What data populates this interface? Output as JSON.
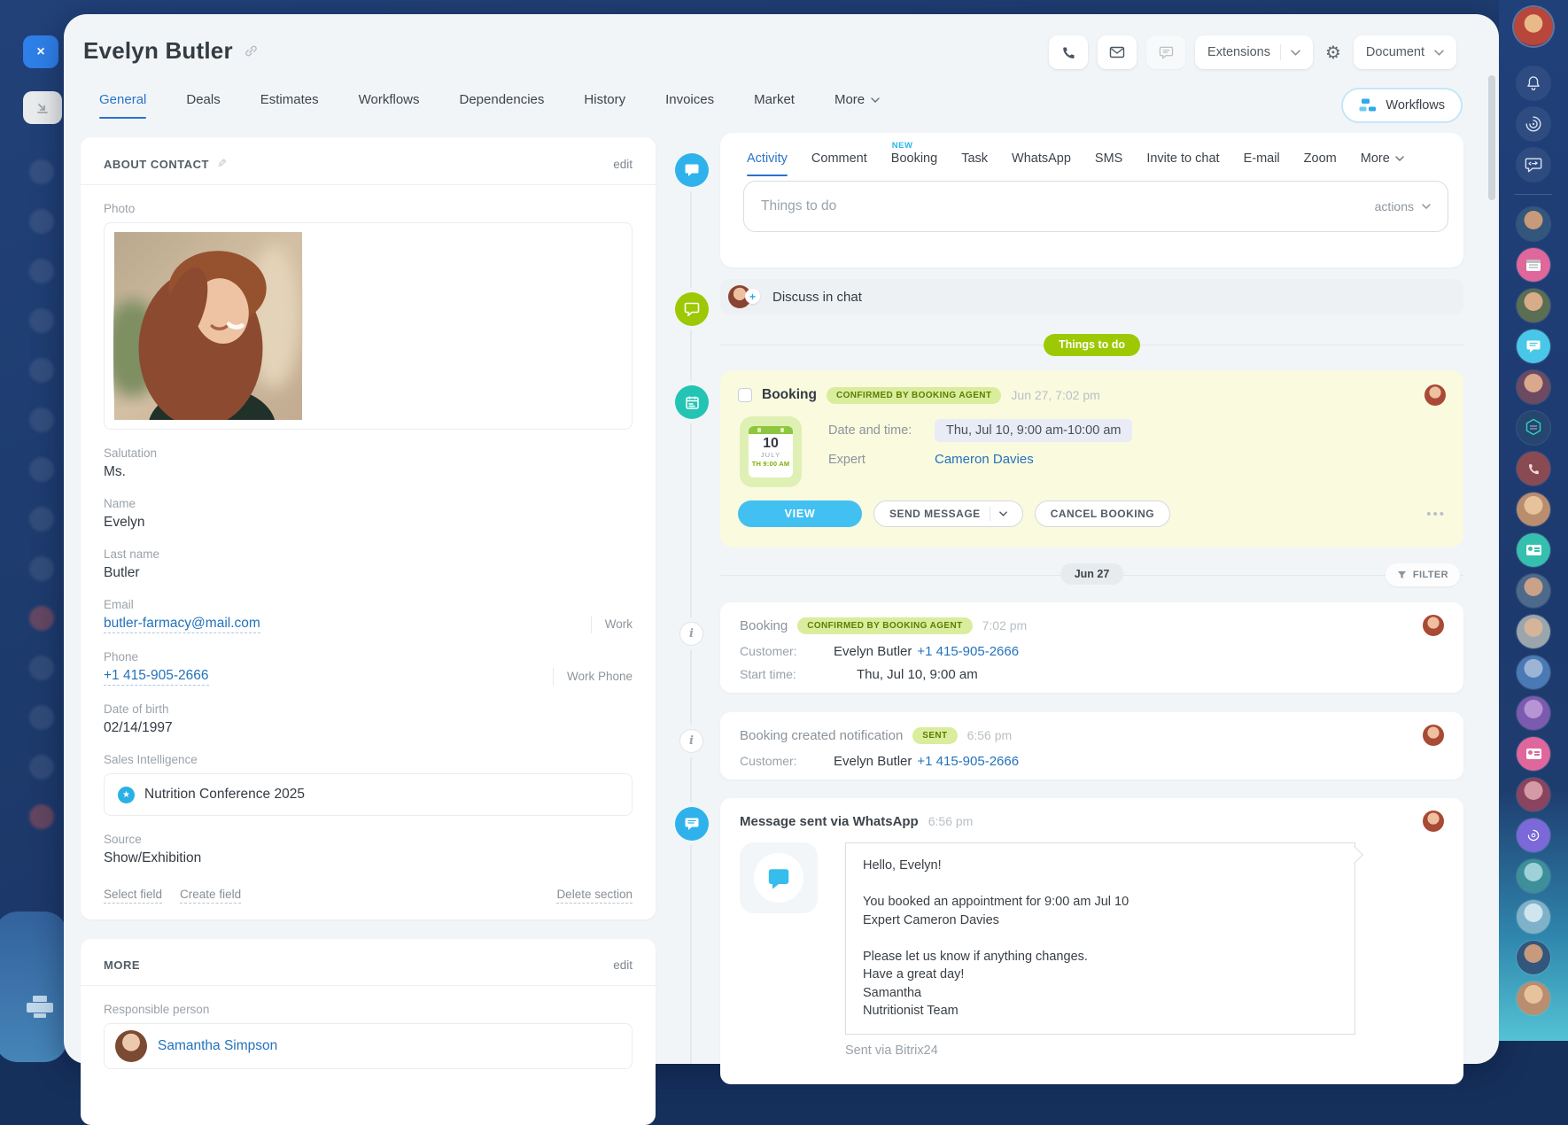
{
  "colors": {
    "navy": "#1d3a6c",
    "accent_blue": "#2a74c9",
    "link_blue": "#2472bd",
    "lime_green": "#9cc903",
    "badge_green_bg": "#d9ed9d",
    "badge_green_text": "#5e7d00",
    "cyan_button": "#43c0f2",
    "booking_card_bg": "#fafadf",
    "new_badge_cyan": "#29b6e8"
  },
  "window": {
    "close_label": "×"
  },
  "header": {
    "title": "Evelyn Butler",
    "extensions_label": "Extensions",
    "document_label": "Document",
    "workflows_button": "Workflows"
  },
  "main_tabs": {
    "items": [
      {
        "label": "General"
      },
      {
        "label": "Deals"
      },
      {
        "label": "Estimates"
      },
      {
        "label": "Workflows"
      },
      {
        "label": "Dependencies"
      },
      {
        "label": "History"
      },
      {
        "label": "Invoices"
      },
      {
        "label": "Market"
      },
      {
        "label": "More"
      }
    ]
  },
  "about": {
    "section_title": "ABOUT CONTACT",
    "edit_label": "edit",
    "photo_label": "Photo",
    "salutation_label": "Salutation",
    "salutation_value": "Ms.",
    "name_label": "Name",
    "name_value": "Evelyn",
    "last_name_label": "Last name",
    "last_name_value": "Butler",
    "email_label": "Email",
    "email_value": "butler-farmacy@mail.com",
    "email_tag": "Work",
    "phone_label": "Phone",
    "phone_value": "+1 415-905-2666",
    "phone_tag": "Work Phone",
    "dob_label": "Date of birth",
    "dob_value": "02/14/1997",
    "si_label": "Sales Intelligence",
    "si_value": "Nutrition Conference 2025",
    "source_label": "Source",
    "source_value": "Show/Exhibition",
    "select_field": "Select field",
    "create_field": "Create field",
    "delete_section": "Delete section"
  },
  "more_card": {
    "section_title": "MORE",
    "edit_label": "edit",
    "responsible_label": "Responsible person",
    "responsible_name": "Samantha Simpson"
  },
  "activity": {
    "tabs": [
      {
        "label": "Activity"
      },
      {
        "label": "Comment"
      },
      {
        "label": "Booking",
        "badge": "NEW"
      },
      {
        "label": "Task"
      },
      {
        "label": "WhatsApp"
      },
      {
        "label": "SMS"
      },
      {
        "label": "Invite to chat"
      },
      {
        "label": "E-mail"
      },
      {
        "label": "Zoom"
      },
      {
        "label": "More"
      }
    ],
    "todo_placeholder": "Things to do",
    "actions_label": "actions",
    "discuss_label": "Discuss in chat",
    "things_pill": "Things to do",
    "date_separator": "Jun 27",
    "filter_label": "FILTER"
  },
  "booking_card": {
    "title": "Booking",
    "badge": "CONFIRMED BY BOOKING AGENT",
    "timestamp": "Jun 27, 7:02 pm",
    "calendar": {
      "day": "10",
      "month": "JULY",
      "slot": "TH 9:00 AM"
    },
    "datetime_label": "Date and time:",
    "datetime_value": "Thu, Jul 10, 9:00 am-10:00 am",
    "expert_label": "Expert",
    "expert_name": "Cameron Davies",
    "view_button": "VIEW",
    "send_message_button": "SEND MESSAGE",
    "cancel_button": "CANCEL BOOKING",
    "more_actions": "•••"
  },
  "timeline": {
    "entry1": {
      "title": "Booking",
      "badge": "CONFIRMED BY BOOKING AGENT",
      "time": "7:02 pm",
      "customer_label": "Customer:",
      "customer_name": "Evelyn Butler",
      "customer_phone": "+1 415-905-2666",
      "start_label": "Start time:",
      "start_value": "Thu, Jul 10, 9:00 am"
    },
    "entry2": {
      "title": "Booking created notification",
      "badge": "SENT",
      "time": "6:56 pm",
      "customer_label": "Customer:",
      "customer_name": "Evelyn Butler",
      "customer_phone": "+1 415-905-2666"
    },
    "entry3": {
      "title": "Message sent via WhatsApp",
      "time": "6:56 pm",
      "message_lines": [
        "Hello, Evelyn!",
        "",
        "You booked an appointment for 9:00 am Jul 10",
        "Expert Cameron Davies",
        "",
        "Please let us know if anything changes.",
        "Have a great day!",
        "Samantha",
        "Nutritionist Team"
      ],
      "footer": "Sent via Bitrix24"
    }
  },
  "icons": {
    "header": [
      "phone-icon",
      "mail-icon",
      "chat-icon",
      "chevron-down-icon",
      "gear-icon",
      "link-icon"
    ],
    "left_rail": [
      "close-icon",
      "dock-panel-icon",
      "printer-icon"
    ],
    "right_rail": [
      "notifications-bell-icon",
      "support24-spiral-icon",
      "chat-redirect-icon",
      "calendar-icon",
      "chat-bubble-icon",
      "hexagon-icon",
      "phone-icon",
      "contact-card-icon",
      "spiral-icon"
    ],
    "timeline_rail": [
      "chat-bubble-icon",
      "chat-bubble-icon",
      "booking-calendar-icon",
      "info-icon",
      "info-icon",
      "chat-bubble-icon"
    ],
    "misc": [
      "pencil-icon",
      "star-icon",
      "filter-funnel-icon",
      "plus-icon",
      "checkbox-icon",
      "whatsapp-bubble-icon"
    ]
  }
}
